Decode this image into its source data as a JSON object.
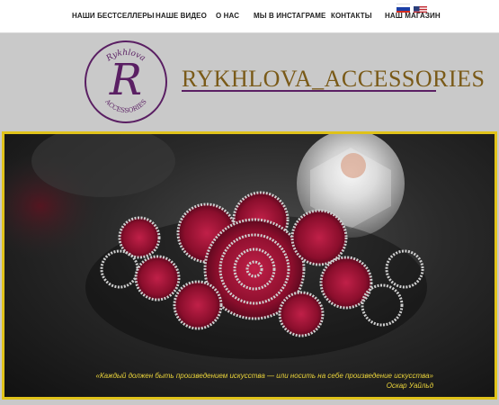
{
  "nav": {
    "items": [
      {
        "label": "НАШИ БЕСТСЕЛЛЕРЫ"
      },
      {
        "label": "НАШЕ ВИДЕО"
      },
      {
        "label": "О НАС"
      },
      {
        "label": "МЫ В ИНСТАГРАМЕ"
      },
      {
        "label": "КОНТАКТЫ"
      },
      {
        "label": "НАШ МАГАЗИН"
      }
    ],
    "flags": [
      "ru-flag-icon",
      "us-flag-icon"
    ]
  },
  "header": {
    "logo_letter": "R",
    "logo_text_top": "Rykhlova",
    "logo_text_bottom": "ACCESSORIES",
    "brand": "RYKHLOVA_ACCESSORIES"
  },
  "hero": {
    "quote": "«Каждый должен быть произведением искусства — или носить на себе произведение искусства»",
    "author": "Оскар Уайльд"
  },
  "colors": {
    "brand_purple": "#5a1f63",
    "brand_gold": "#7a5a18",
    "frame_yellow": "#e0c21a",
    "quote_yellow": "#e8d23a"
  }
}
